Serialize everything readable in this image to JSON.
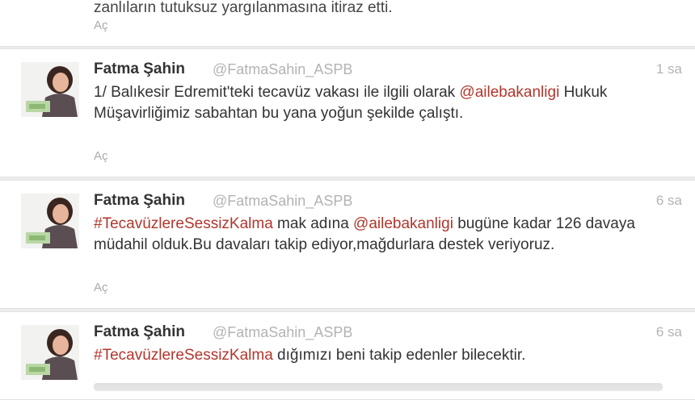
{
  "tweet0": {
    "text": "zanlıların tutuksuz yargılanmasına itiraz etti.",
    "expand": "Aç"
  },
  "tweet1": {
    "name": "Fatma Şahin",
    "handle": "@FatmaSahin_ASPB",
    "time": "1 sa",
    "text_1": "1/ Balıkesir Edremit'teki tecavüz vakası ile ilgili olarak ",
    "mention": "@ailebakanligi",
    "text_2": " Hukuk Müşavirliğimiz sabahtan bu yana yoğun şekilde çalıştı.",
    "expand": "Aç"
  },
  "tweet2": {
    "name": "Fatma Şahin",
    "handle": "@FatmaSahin_ASPB",
    "time": "6 sa",
    "hashtag": "#TecavüzlereSessizKalma",
    "text_1": " mak adına ",
    "mention": "@ailebakanligi",
    "text_2": " bugüne kadar 126 davaya müdahil olduk.Bu davaları takip ediyor,mağdurlara destek veriyoruz.",
    "expand": "Aç"
  },
  "tweet3": {
    "name": "Fatma Şahin",
    "handle": "@FatmaSahin_ASPB",
    "time": "6 sa",
    "hashtag": "#TecavüzlereSessizKalma",
    "text_1": " dığımızı beni takip edenler bilecektir."
  },
  "colors": {
    "link": "#b2362c",
    "muted": "#b3b3b3",
    "background": "#ececec"
  }
}
